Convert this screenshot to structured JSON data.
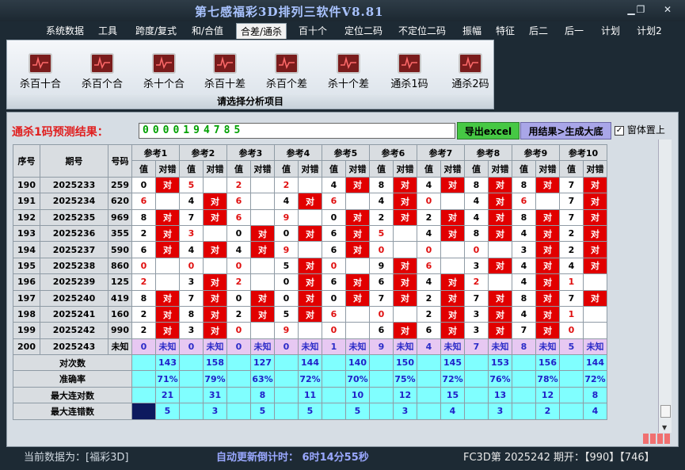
{
  "app": {
    "title": "第七感福彩3D排列三软件V8.81"
  },
  "menu": [
    "系统数据",
    "工具",
    "跨度/复式",
    "和/合值",
    "合差/通杀",
    "百十个",
    "定位二码",
    "不定位二码",
    "振幅",
    "特征",
    "后二",
    "后一",
    "计划",
    "计划2"
  ],
  "menu_active": 4,
  "ribbon": {
    "buttons": [
      "杀百十合",
      "杀百个合",
      "杀十个合",
      "杀百十差",
      "杀百个差",
      "杀十个差",
      "通杀1码",
      "通杀2码"
    ],
    "caption": "请选择分析项目"
  },
  "prediction": {
    "label": "通杀1码预测结果：",
    "value": "0000194785",
    "export_label": "导出excel",
    "generate_label": "用结果>生成大底",
    "topmost_label": "窗体置上",
    "topmost_checked": "✓"
  },
  "table": {
    "headers": {
      "seq": "序号",
      "period": "期号",
      "number": "号码",
      "refs": [
        "参考1",
        "参考2",
        "参考3",
        "参考4",
        "参考5",
        "参考6",
        "参考7",
        "参考8",
        "参考9",
        "参考10"
      ],
      "val": "值",
      "ok": "对错"
    },
    "rows": [
      {
        "seq": "190",
        "period": "2025233",
        "num": "259",
        "vals": [
          "0",
          "5",
          "2",
          "2",
          "4",
          "8",
          "4",
          "8",
          "8",
          "7"
        ],
        "hits": [
          1,
          0,
          0,
          0,
          1,
          1,
          1,
          1,
          1,
          1
        ],
        "redv": [
          0,
          1,
          1,
          1,
          0,
          0,
          0,
          0,
          0,
          0
        ]
      },
      {
        "seq": "191",
        "period": "2025234",
        "num": "620",
        "vals": [
          "6",
          "4",
          "6",
          "4",
          "6",
          "4",
          "0",
          "4",
          "6",
          "7"
        ],
        "hits": [
          0,
          1,
          0,
          1,
          0,
          1,
          0,
          1,
          0,
          1
        ],
        "redv": [
          1,
          0,
          1,
          0,
          1,
          0,
          1,
          0,
          1,
          0
        ]
      },
      {
        "seq": "192",
        "period": "2025235",
        "num": "969",
        "vals": [
          "8",
          "7",
          "6",
          "9",
          "0",
          "2",
          "2",
          "4",
          "8",
          "7"
        ],
        "hits": [
          1,
          1,
          0,
          0,
          1,
          1,
          1,
          1,
          1,
          1
        ],
        "redv": [
          0,
          0,
          1,
          1,
          0,
          0,
          0,
          0,
          0,
          0
        ]
      },
      {
        "seq": "193",
        "period": "2025236",
        "num": "355",
        "vals": [
          "2",
          "3",
          "0",
          "0",
          "6",
          "5",
          "4",
          "8",
          "4",
          "2"
        ],
        "hits": [
          1,
          0,
          1,
          1,
          1,
          0,
          1,
          1,
          1,
          1
        ],
        "redv": [
          0,
          1,
          0,
          0,
          0,
          1,
          0,
          0,
          0,
          0
        ]
      },
      {
        "seq": "194",
        "period": "2025237",
        "num": "590",
        "vals": [
          "6",
          "4",
          "4",
          "9",
          "6",
          "0",
          "0",
          "0",
          "3",
          "2"
        ],
        "hits": [
          1,
          1,
          1,
          0,
          1,
          0,
          0,
          0,
          1,
          1
        ],
        "redv": [
          0,
          0,
          0,
          1,
          0,
          1,
          1,
          1,
          0,
          0
        ]
      },
      {
        "seq": "195",
        "period": "2025238",
        "num": "860",
        "vals": [
          "0",
          "0",
          "0",
          "5",
          "0",
          "9",
          "6",
          "3",
          "4",
          "4"
        ],
        "hits": [
          0,
          0,
          0,
          1,
          0,
          1,
          0,
          1,
          1,
          1
        ],
        "redv": [
          1,
          1,
          1,
          0,
          1,
          0,
          1,
          0,
          0,
          0
        ]
      },
      {
        "seq": "196",
        "period": "2025239",
        "num": "125",
        "vals": [
          "2",
          "3",
          "2",
          "0",
          "6",
          "6",
          "4",
          "2",
          "4",
          "1"
        ],
        "hits": [
          0,
          1,
          0,
          1,
          1,
          1,
          1,
          0,
          1,
          0
        ],
        "redv": [
          1,
          0,
          1,
          0,
          0,
          0,
          0,
          1,
          0,
          1
        ]
      },
      {
        "seq": "197",
        "period": "2025240",
        "num": "419",
        "vals": [
          "8",
          "7",
          "0",
          "0",
          "0",
          "7",
          "2",
          "7",
          "8",
          "7"
        ],
        "hits": [
          1,
          1,
          1,
          1,
          1,
          1,
          1,
          1,
          1,
          1
        ],
        "redv": [
          0,
          0,
          0,
          0,
          0,
          0,
          0,
          0,
          0,
          0
        ]
      },
      {
        "seq": "198",
        "period": "2025241",
        "num": "160",
        "vals": [
          "2",
          "8",
          "2",
          "5",
          "6",
          "0",
          "2",
          "3",
          "4",
          "1"
        ],
        "hits": [
          1,
          1,
          1,
          1,
          0,
          0,
          1,
          1,
          1,
          0
        ],
        "redv": [
          0,
          0,
          0,
          0,
          1,
          1,
          0,
          0,
          0,
          1
        ]
      },
      {
        "seq": "199",
        "period": "2025242",
        "num": "990",
        "vals": [
          "2",
          "3",
          "0",
          "9",
          "0",
          "6",
          "6",
          "3",
          "7",
          "0"
        ],
        "hits": [
          1,
          1,
          0,
          0,
          0,
          1,
          1,
          1,
          1,
          0
        ],
        "redv": [
          0,
          0,
          1,
          1,
          1,
          0,
          0,
          0,
          0,
          1
        ]
      }
    ],
    "pending": {
      "seq": "200",
      "period": "2025243",
      "num": "未知",
      "vals": [
        "0",
        "0",
        "0",
        "0",
        "1",
        "9",
        "4",
        "7",
        "8",
        "5"
      ],
      "unknown": "未知"
    },
    "stats": [
      {
        "label": "对次数",
        "values": [
          "143",
          "158",
          "127",
          "144",
          "140",
          "150",
          "145",
          "153",
          "156",
          "144"
        ]
      },
      {
        "label": "准确率",
        "values": [
          "71%",
          "79%",
          "63%",
          "72%",
          "70%",
          "75%",
          "72%",
          "76%",
          "78%",
          "72%"
        ]
      },
      {
        "label": "最大连对数",
        "values": [
          "21",
          "31",
          "8",
          "11",
          "10",
          "12",
          "15",
          "13",
          "12",
          "8"
        ]
      },
      {
        "label": "最大连错数",
        "values": [
          "5",
          "3",
          "5",
          "5",
          "5",
          "3",
          "4",
          "3",
          "2",
          "4"
        ]
      }
    ],
    "hit_mark": "对"
  },
  "status": {
    "current": "当前数据为：[福彩3D]",
    "countdown": "自动更新倒计时： 6时14分55秒",
    "latest": "FC3D第 2025242 期开：【990】【746】"
  }
}
